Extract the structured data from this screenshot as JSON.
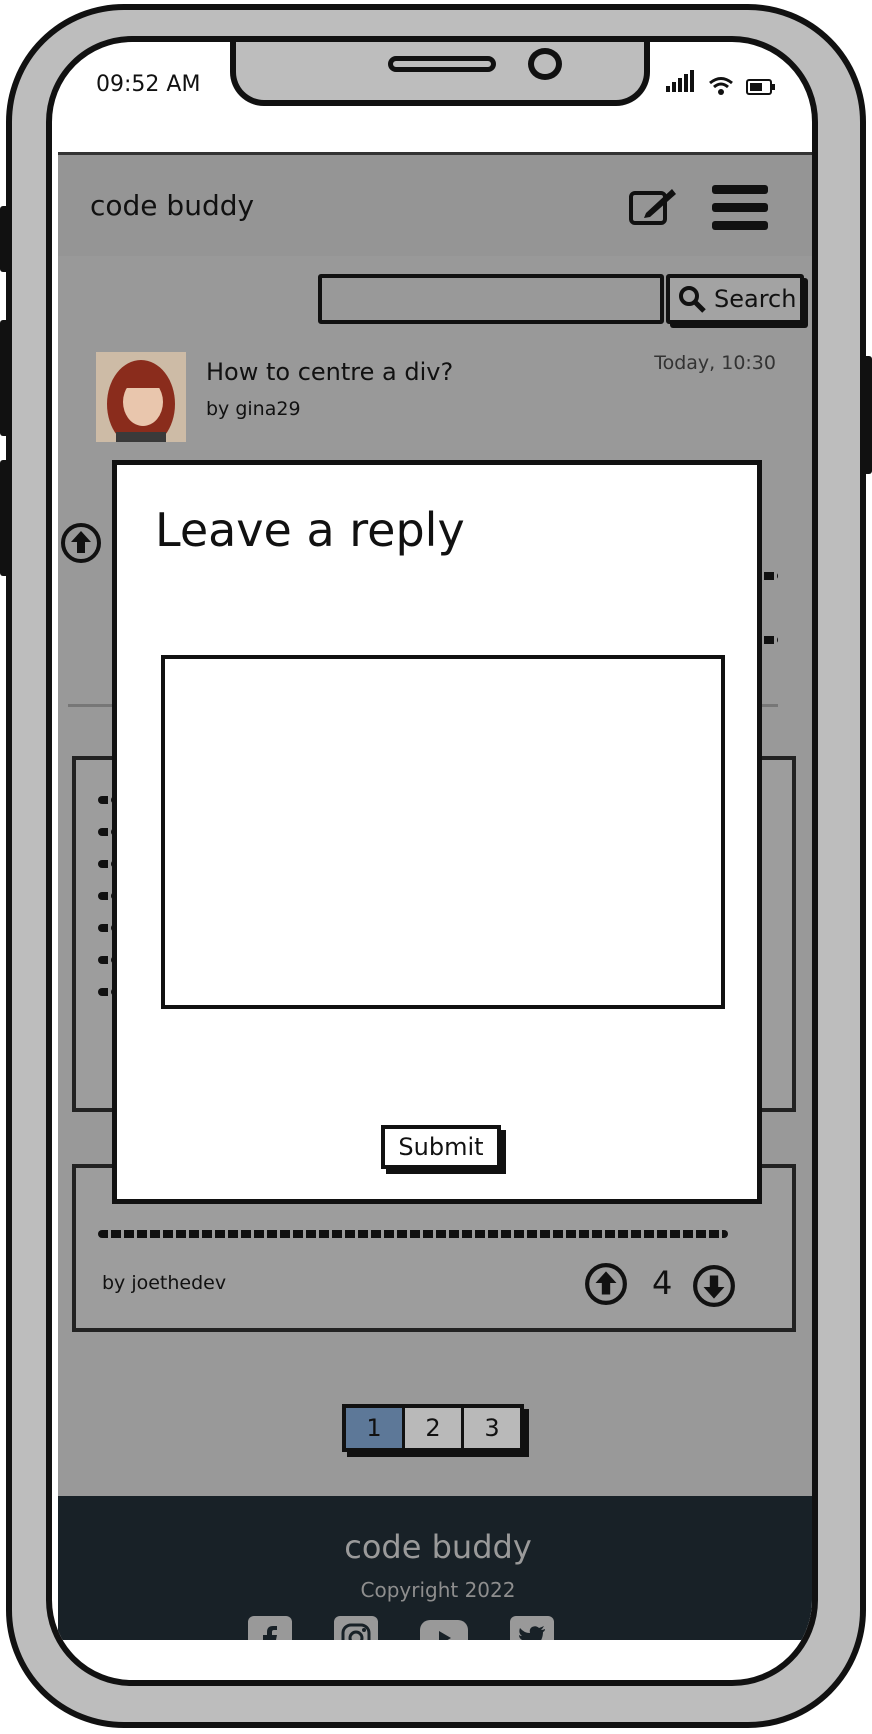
{
  "status_bar": {
    "time": "09:52 AM"
  },
  "header": {
    "brand": "code buddy"
  },
  "search": {
    "button_label": "Search",
    "placeholder": ""
  },
  "post": {
    "title": "How to centre a div?",
    "author": "by gina29",
    "time": "Today, 10:30"
  },
  "answer_card": {
    "author": "by joethedev",
    "votes": "4"
  },
  "pagination": {
    "pages": [
      "1",
      "2",
      "3"
    ],
    "active": "1"
  },
  "footer": {
    "brand": "code buddy",
    "copyright": "Copyright 2022",
    "social": [
      "facebook-icon",
      "instagram-icon",
      "youtube-icon",
      "twitter-icon"
    ]
  },
  "modal": {
    "title": "Leave a reply",
    "textarea_value": "",
    "submit_label": "Submit"
  },
  "colors": {
    "app_bg": "#999999",
    "footer_bg": "#182127",
    "active_page": "#5d7898",
    "modal_bg": "#ffffff"
  }
}
